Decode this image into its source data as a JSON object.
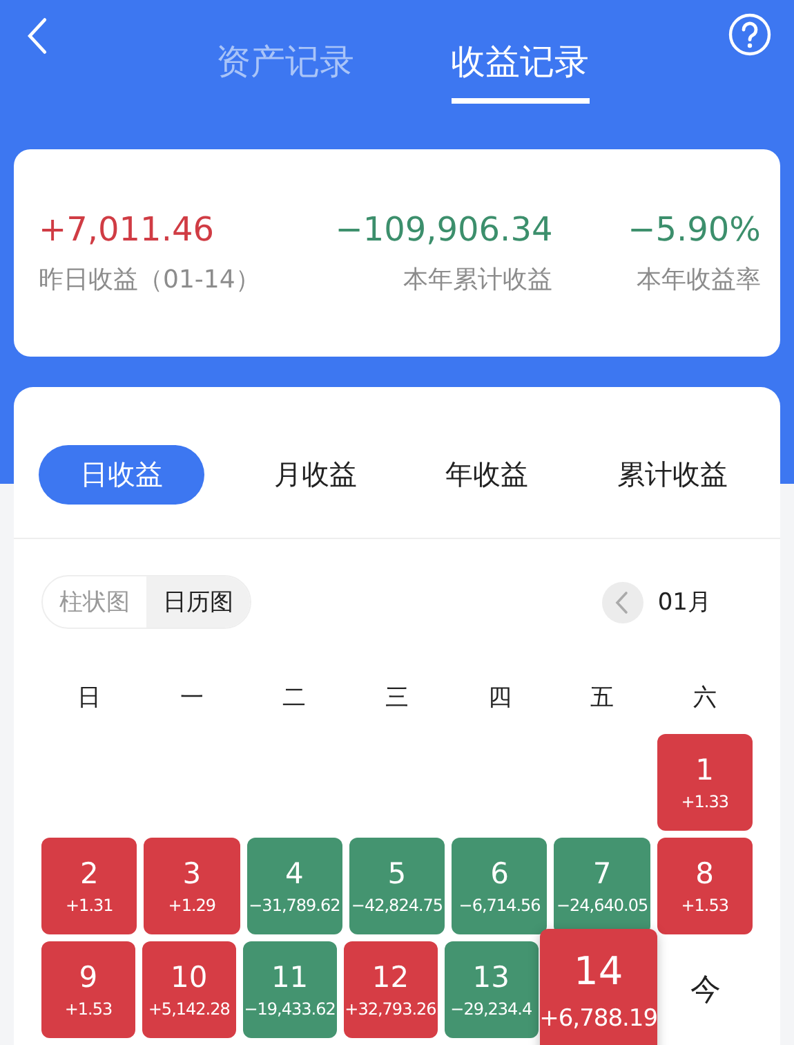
{
  "header": {
    "tabs": [
      {
        "label": "资产记录",
        "selected": false
      },
      {
        "label": "收益记录",
        "selected": true
      }
    ]
  },
  "summary": [
    {
      "value": "+7,011.46",
      "label": "昨日收益（01-14）",
      "kind": "gain"
    },
    {
      "value": "−109,906.34",
      "label": "本年累计收益",
      "kind": "loss"
    },
    {
      "value": "−5.90%",
      "label": "本年收益率",
      "kind": "loss"
    }
  ],
  "period_tabs": [
    {
      "label": "日收益",
      "selected": true
    },
    {
      "label": "月收益",
      "selected": false
    },
    {
      "label": "年收益",
      "selected": false
    },
    {
      "label": "累计收益",
      "selected": false
    }
  ],
  "view_toggle": [
    {
      "label": "柱状图",
      "selected": false
    },
    {
      "label": "日历图",
      "selected": true
    }
  ],
  "month": "01月",
  "weekdays": [
    "日",
    "一",
    "二",
    "三",
    "四",
    "五",
    "六"
  ],
  "weeks": [
    {
      "kind": "first",
      "days": [
        {
          "day": "1",
          "value": "+1.33",
          "kind": "gain",
          "selected": false
        }
      ]
    },
    {
      "kind": "full",
      "days": [
        {
          "day": "2",
          "value": "+1.31",
          "kind": "gain",
          "selected": false
        },
        {
          "day": "3",
          "value": "+1.29",
          "kind": "gain",
          "selected": false
        },
        {
          "day": "4",
          "value": "−31,789.62",
          "kind": "loss",
          "selected": false
        },
        {
          "day": "5",
          "value": "−42,824.75",
          "kind": "loss",
          "selected": false
        },
        {
          "day": "6",
          "value": "−6,714.56",
          "kind": "loss",
          "selected": false
        },
        {
          "day": "7",
          "value": "−24,640.05",
          "kind": "loss",
          "selected": false
        },
        {
          "day": "8",
          "value": "+1.53",
          "kind": "gain",
          "selected": false
        }
      ]
    },
    {
      "kind": "full",
      "days": [
        {
          "day": "9",
          "value": "+1.53",
          "kind": "gain",
          "selected": false
        },
        {
          "day": "10",
          "value": "+5,142.28",
          "kind": "gain",
          "selected": false
        },
        {
          "day": "11",
          "value": "−19,433.62",
          "kind": "loss",
          "selected": false
        },
        {
          "day": "12",
          "value": "+32,793.26",
          "kind": "gain",
          "selected": false
        },
        {
          "day": "13",
          "value": "−29,234.4",
          "kind": "loss",
          "selected": false
        },
        {
          "day": "14",
          "value": "+6,788.19",
          "kind": "gain",
          "selected": true
        },
        {
          "day": "今",
          "kind": "plain",
          "selected": false
        }
      ]
    }
  ]
}
